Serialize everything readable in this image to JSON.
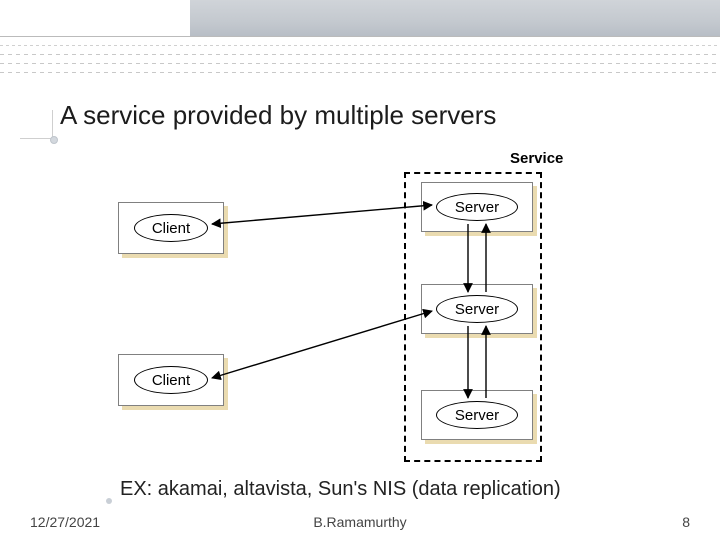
{
  "title": "A service provided by multiple servers",
  "caption": "EX: akamai, altavista, Sun's NIS (data replication)",
  "service_label": "Service",
  "nodes": {
    "client1": "Client",
    "client2": "Client",
    "server1": "Server",
    "server2": "Server",
    "server3": "Server"
  },
  "footer": {
    "date": "12/27/2021",
    "author": "B.Ramamurthy",
    "page": "8"
  },
  "colors": {
    "shadow": "#eadbb0",
    "band_grey": "#c4c9cf"
  },
  "chart_data": {
    "type": "diagram",
    "title": "A service provided by multiple servers",
    "nodes": [
      {
        "id": "client1",
        "label": "Client",
        "kind": "client"
      },
      {
        "id": "client2",
        "label": "Client",
        "kind": "client"
      },
      {
        "id": "server1",
        "label": "Server",
        "kind": "server",
        "group": "Service"
      },
      {
        "id": "server2",
        "label": "Server",
        "kind": "server",
        "group": "Service"
      },
      {
        "id": "server3",
        "label": "Server",
        "kind": "server",
        "group": "Service"
      }
    ],
    "edges": [
      {
        "from": "client1",
        "to": "server1",
        "bidirectional": true
      },
      {
        "from": "client2",
        "to": "server2",
        "bidirectional": true
      },
      {
        "from": "server1",
        "to": "server2",
        "bidirectional": true
      },
      {
        "from": "server2",
        "to": "server3",
        "bidirectional": true
      }
    ],
    "groups": [
      {
        "id": "Service",
        "label": "Service",
        "members": [
          "server1",
          "server2",
          "server3"
        ],
        "style": "dashed-box"
      }
    ],
    "annotations": [
      "EX: akamai, altavista, Sun's NIS (data replication)"
    ]
  }
}
